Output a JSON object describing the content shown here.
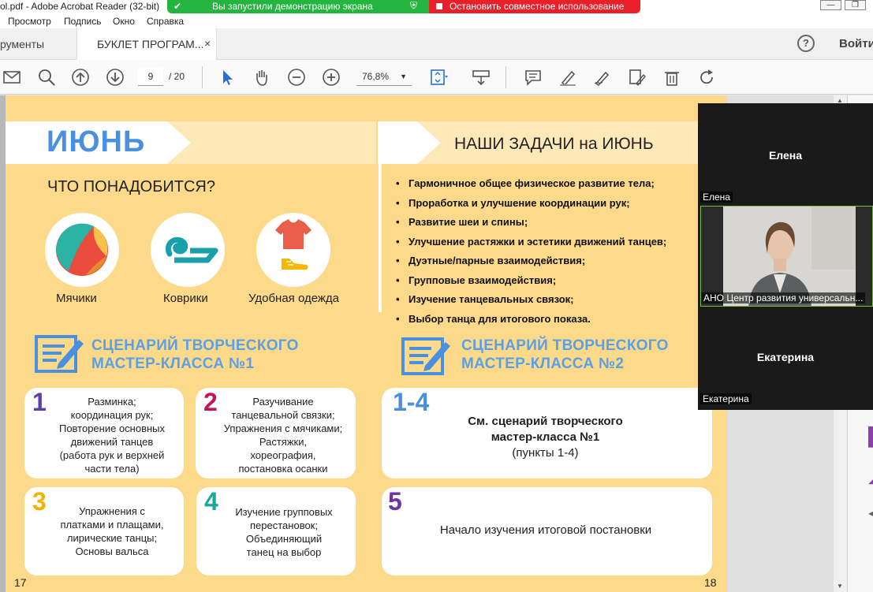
{
  "titlebar": {
    "app_title": "ol.pdf - Adobe Acrobat Reader (32-bit)"
  },
  "share_banner": {
    "text": "Вы запустили демонстрацию экрана",
    "stop_label": "Остановить совместное использование"
  },
  "menu": {
    "items": [
      "Просмотр",
      "Подпись",
      "Окно",
      "Справка"
    ]
  },
  "tabs": {
    "tools": "рументы",
    "doc": "БУКЛЕТ ПРОГРАМ...",
    "close": "×",
    "signin": "Войти",
    "help": "?"
  },
  "toolbar": {
    "page_current": "9",
    "page_total": "/ 20",
    "zoom": "76,8%"
  },
  "page": {
    "june_title": "ИЮНЬ",
    "tasks_title": "НАШИ ЗАДАЧИ на ИЮНЬ",
    "need_title": "ЧТО ПОНАДОБИТСЯ?",
    "items": [
      "Мячики",
      "Коврики",
      "Удобная одежда"
    ],
    "tasks": [
      "Гармоничное общее физическое развитие тела;",
      "Проработка и улучшение координации рук;",
      "Развитие шеи и спины;",
      "Улучшение растяжки и эстетики движений танцев;",
      "Дуэтные/парные взаимодействия;",
      "Групповые взаимодействия;",
      "Изучение танцевальных связок;",
      "Выбор танца для итогового показа."
    ],
    "scenario1": {
      "line1": "СЦЕНАРИЙ ТВОРЧЕСКОГО",
      "line2": "МАСТЕР-КЛАССА №1"
    },
    "scenario2": {
      "line1": "СЦЕНАРИЙ ТВОРЧЕСКОГО",
      "line2": "МАСТЕР-КЛАССА №2"
    },
    "cards": [
      {
        "num": "1",
        "color": "#5a3fb0",
        "lines": [
          "Разминка;",
          "координация рук;",
          "Повторение основных",
          "движений танцев",
          "(работа рук и верхней",
          "части тела)"
        ]
      },
      {
        "num": "2",
        "color": "#c2185b",
        "lines": [
          "Разучивание",
          "танцевальной связки;",
          "Упражнения с мячиками;",
          "Растяжки,",
          "хореография,",
          "постановка осанки"
        ]
      },
      {
        "num": "3",
        "color": "#f0b400",
        "lines": [
          "Упражнения с",
          "платками и плащами,",
          "лирические танцы;",
          "Основы вальса"
        ]
      },
      {
        "num": "4",
        "color": "#19a89a",
        "lines": [
          "Изучение групповых",
          "перестановок;",
          "Объединяющий",
          "танец на выбор"
        ]
      },
      {
        "num": "1-4",
        "color": "#4a90e0",
        "lines": [
          "См. сценарий творческого",
          "мастер-класса №1",
          "(пункты 1-4)"
        ]
      },
      {
        "num": "5",
        "color": "#6a35a0",
        "lines": [
          "Начало изучения итоговой постановки"
        ]
      }
    ],
    "page_left": "17",
    "page_right": "18"
  },
  "video": {
    "tile1_name": "Елена",
    "tile1_label": "Елена",
    "tile2_label": "АНО Центр развития универсальн...",
    "tile3_name": "Екатерина",
    "tile3_label": "Екатерина"
  },
  "colors": {
    "page_bg": "#fdd98a",
    "accent_blue": "#5b9fe6",
    "share_green": "#23b53f",
    "stop_red": "#e8202a"
  }
}
